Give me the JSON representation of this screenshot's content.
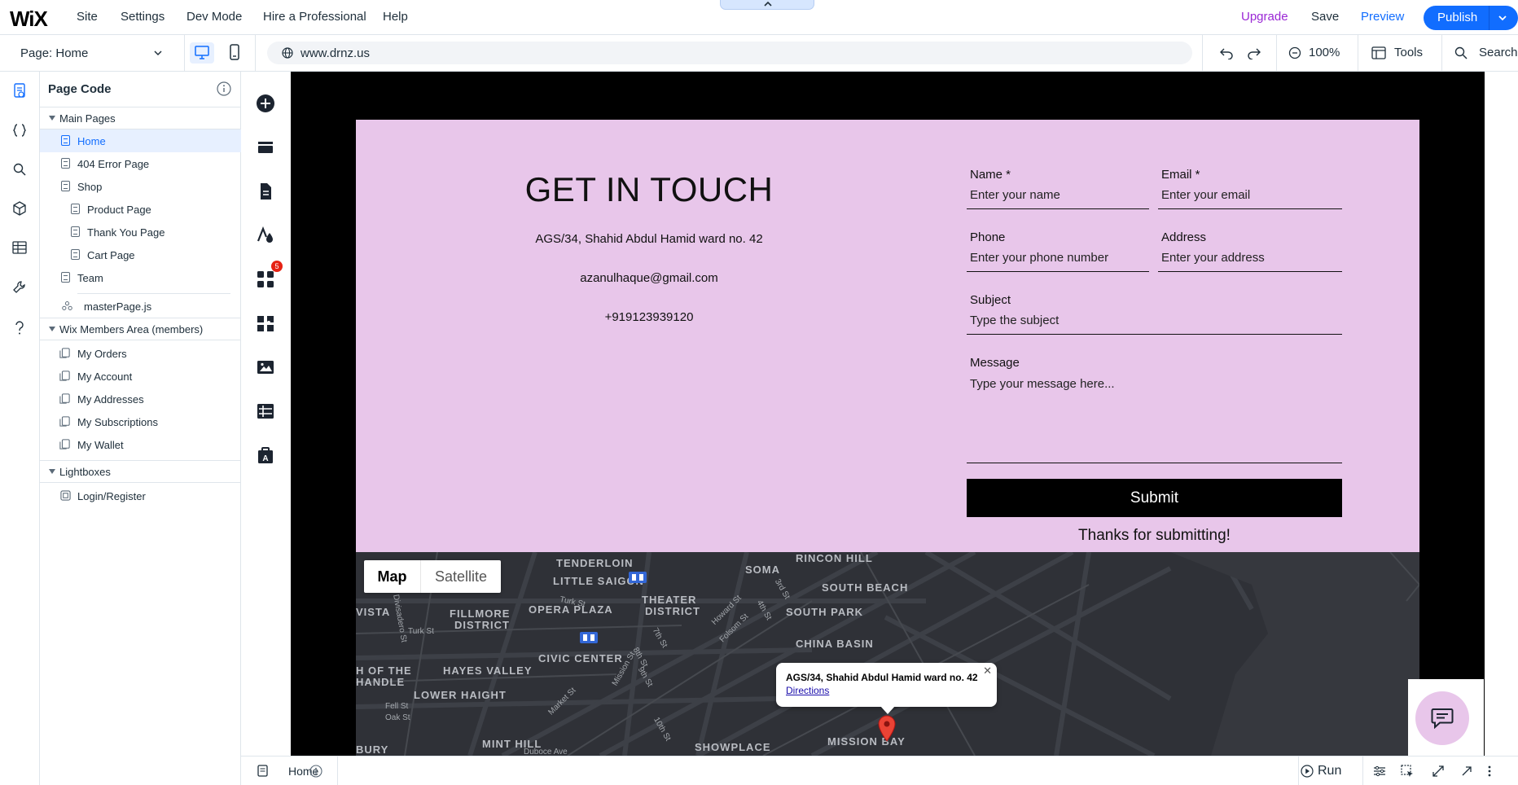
{
  "topbar": {
    "logo": "WiX",
    "menu": [
      "Site",
      "Settings",
      "Dev Mode",
      "Hire a Professional",
      "Help"
    ],
    "upgrade": "Upgrade",
    "save": "Save",
    "preview": "Preview",
    "publish": "Publish"
  },
  "toolbar": {
    "page_label": "Page:",
    "page_value": "Home",
    "url": "www.drnz.us",
    "zoom": "100%",
    "tools": "Tools",
    "search": "Search"
  },
  "panel": {
    "title": "Page Code",
    "main_pages_label": "Main Pages",
    "main_pages": [
      "Home",
      "404 Error Page",
      "Shop",
      "Product Page",
      "Thank You Page",
      "Cart Page",
      "Team"
    ],
    "master_page": "masterPage.js",
    "members_label": "Wix Members Area (members)",
    "members_pages": [
      "My Orders",
      "My Account",
      "My Addresses",
      "My Subscriptions",
      "My Wallet"
    ],
    "lightboxes_label": "Lightboxes",
    "lightboxes": [
      "Login/Register"
    ]
  },
  "tools": {
    "apps_badge": "5"
  },
  "site": {
    "heading": "GET IN TOUCH",
    "address": "AGS/34, Shahid Abdul Hamid ward no. 42",
    "email": "azanulhaque@gmail.com",
    "phone": "+919123939120",
    "form": {
      "name_label": "Name *",
      "name_placeholder": "Enter your name",
      "email_label": "Email *",
      "email_placeholder": "Enter your email",
      "phone_label": "Phone",
      "phone_placeholder": "Enter your phone number",
      "address_label": "Address",
      "address_placeholder": "Enter your address",
      "subject_label": "Subject",
      "subject_placeholder": "Type the subject",
      "message_label": "Message",
      "message_placeholder": "Type your message here...",
      "submit": "Submit",
      "thanks": "Thanks for submitting!"
    },
    "map": {
      "toggle_map": "Map",
      "toggle_satellite": "Satellite",
      "popup_title": "AGS/34, Shahid Abdul Hamid ward no. 42",
      "popup_link": "Directions",
      "areas": [
        "TENDERLOIN",
        "RINCON HILL",
        "LITTLE SAIGON",
        "SOMA",
        "SOUTH BEACH",
        "THEATER",
        "DISTRICT",
        "OPERA PLAZA",
        "FILLMORE",
        "DISTRICT",
        "SOUTH PARK",
        "CHINA BASIN",
        "CIVIC CENTER",
        "HAYES VALLEY",
        "LOWER HAIGHT",
        "MINT HILL",
        "SHOWPLACE",
        "MISSION BAY",
        "VISTA",
        "H OF THE",
        "HANDLE",
        "BURY"
      ],
      "streets": [
        "Turk St",
        "Turk St",
        "Howard St",
        "Folsom St",
        "7th St",
        "8th St",
        "Mission St",
        "9th St",
        "Market St",
        "10th St",
        "Fell St",
        "Oak St",
        "Divisadero St",
        "Duboce Ave",
        "3rd St",
        "4th St"
      ]
    }
  },
  "bottombar": {
    "page": "Home",
    "run": "Run"
  },
  "colors": {
    "accent": "#116dff",
    "upgrade": "#9a27d5",
    "contact_bg": "#e8c6ea",
    "map_bg": "#2f3137"
  }
}
